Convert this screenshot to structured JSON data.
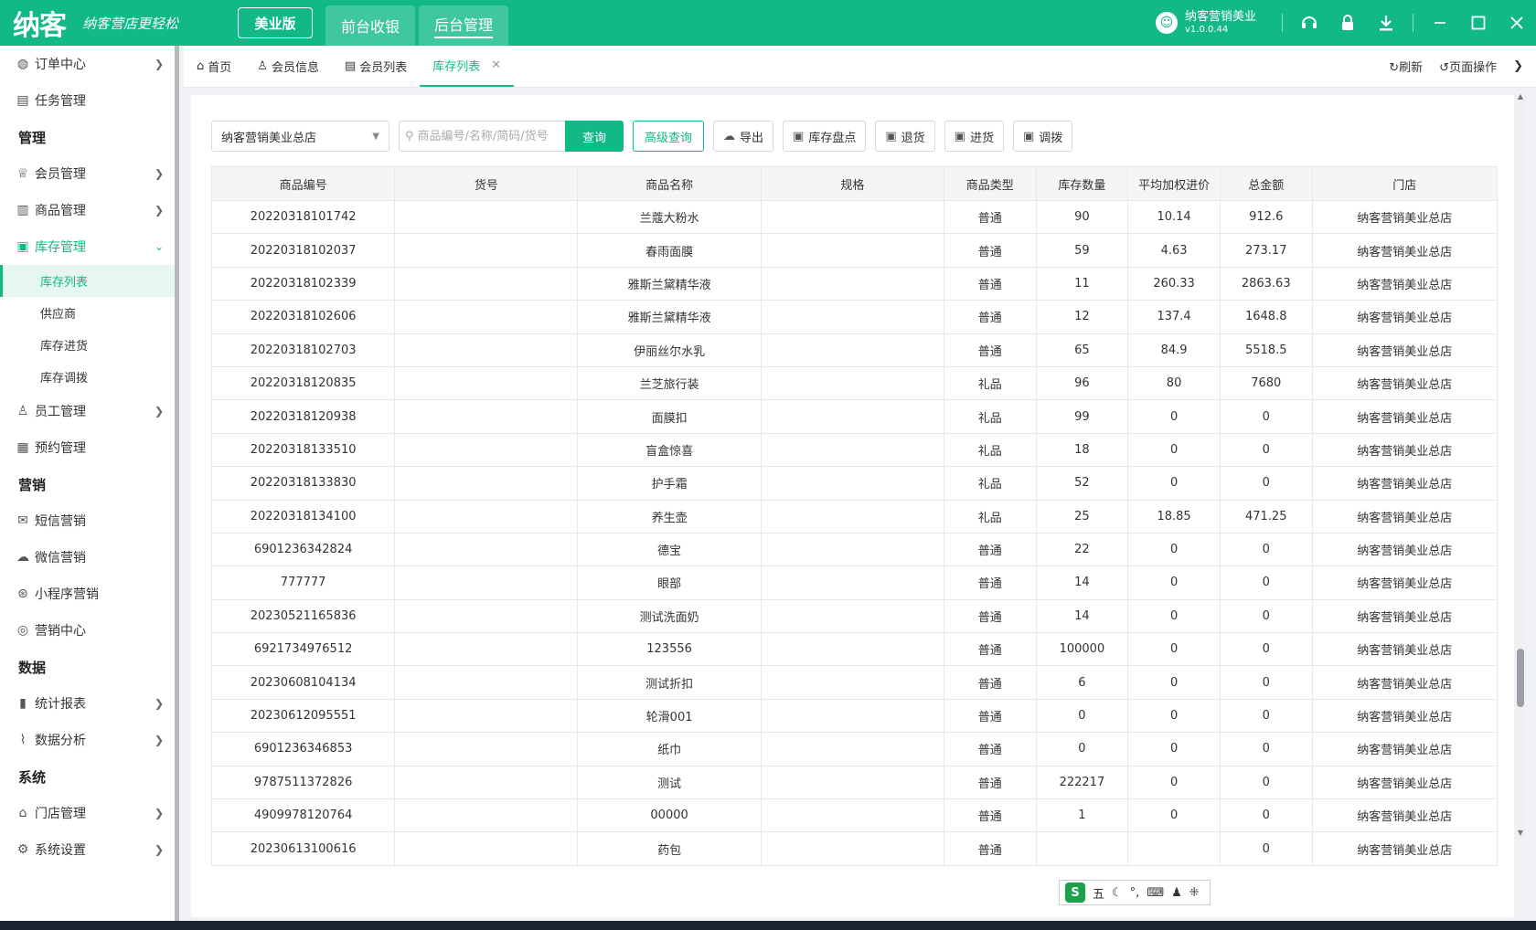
{
  "header": {
    "logo": "纳客",
    "slogan": "纳客营店更轻松",
    "edition": "美业版",
    "mode_tabs": [
      "前台收银",
      "后台管理"
    ],
    "user_name": "纳客营销美业",
    "version": "v1.0.0.44"
  },
  "sidebar": {
    "order_center": "订单中心",
    "task_mgmt": "任务管理",
    "section_manage": "管理",
    "member_mgmt": "会员管理",
    "product_mgmt": "商品管理",
    "inventory_mgmt": "库存管理",
    "inventory_sub": [
      "库存列表",
      "供应商",
      "库存进货",
      "库存调拨"
    ],
    "staff_mgmt": "员工管理",
    "booking_mgmt": "预约管理",
    "section_marketing": "营销",
    "sms_marketing": "短信营销",
    "wechat_marketing": "微信营销",
    "miniapp_marketing": "小程序营销",
    "marketing_center": "营销中心",
    "section_data": "数据",
    "stats_report": "统计报表",
    "data_analysis": "数据分析",
    "section_system": "系统",
    "store_mgmt": "门店管理",
    "system_settings": "系统设置"
  },
  "tabs": {
    "home": "首页",
    "member_info": "会员信息",
    "member_list": "会员列表",
    "inventory_list": "库存列表",
    "refresh": "刷新",
    "page_ops": "页面操作"
  },
  "toolbar": {
    "store": "纳客营销美业总店",
    "search_placeholder": "商品编号/名称/简码/货号",
    "query": "查询",
    "advanced": "高级查询",
    "export": "导出",
    "stocktake": "库存盘点",
    "return": "退货",
    "purchase": "进货",
    "transfer": "调拨"
  },
  "table": {
    "headers": [
      "商品编号",
      "货号",
      "商品名称",
      "规格",
      "商品类型",
      "库存数量",
      "平均加权进价",
      "总金额",
      "门店"
    ],
    "rows": [
      [
        "20220318101742",
        "",
        "兰蔻大粉水",
        "",
        "普通",
        "90",
        "10.14",
        "912.6",
        "纳客营销美业总店"
      ],
      [
        "20220318102037",
        "",
        "春雨面膜",
        "",
        "普通",
        "59",
        "4.63",
        "273.17",
        "纳客营销美业总店"
      ],
      [
        "20220318102339",
        "",
        "雅斯兰黛精华液",
        "",
        "普通",
        "11",
        "260.33",
        "2863.63",
        "纳客营销美业总店"
      ],
      [
        "20220318102606",
        "",
        "雅斯兰黛精华液",
        "",
        "普通",
        "12",
        "137.4",
        "1648.8",
        "纳客营销美业总店"
      ],
      [
        "20220318102703",
        "",
        "伊丽丝尔水乳",
        "",
        "普通",
        "65",
        "84.9",
        "5518.5",
        "纳客营销美业总店"
      ],
      [
        "20220318120835",
        "",
        "兰芝旅行装",
        "",
        "礼品",
        "96",
        "80",
        "7680",
        "纳客营销美业总店"
      ],
      [
        "20220318120938",
        "",
        "面膜扣",
        "",
        "礼品",
        "99",
        "0",
        "0",
        "纳客营销美业总店"
      ],
      [
        "20220318133510",
        "",
        "盲盒惊喜",
        "",
        "礼品",
        "18",
        "0",
        "0",
        "纳客营销美业总店"
      ],
      [
        "20220318133830",
        "",
        "护手霜",
        "",
        "礼品",
        "52",
        "0",
        "0",
        "纳客营销美业总店"
      ],
      [
        "20220318134100",
        "",
        "养生壶",
        "",
        "礼品",
        "25",
        "18.85",
        "471.25",
        "纳客营销美业总店"
      ],
      [
        "6901236342824",
        "",
        "德宝",
        "",
        "普通",
        "22",
        "0",
        "0",
        "纳客营销美业总店"
      ],
      [
        "777777",
        "",
        "眼部",
        "",
        "普通",
        "14",
        "0",
        "0",
        "纳客营销美业总店"
      ],
      [
        "20230521165836",
        "",
        "测试洗面奶",
        "",
        "普通",
        "14",
        "0",
        "0",
        "纳客营销美业总店"
      ],
      [
        "6921734976512",
        "",
        "123556",
        "",
        "普通",
        "100000",
        "0",
        "0",
        "纳客营销美业总店"
      ],
      [
        "20230608104134",
        "",
        "测试折扣",
        "",
        "普通",
        "6",
        "0",
        "0",
        "纳客营销美业总店"
      ],
      [
        "20230612095551",
        "",
        "轮滑001",
        "",
        "普通",
        "0",
        "0",
        "0",
        "纳客营销美业总店"
      ],
      [
        "6901236346853",
        "",
        "纸巾",
        "",
        "普通",
        "0",
        "0",
        "0",
        "纳客营销美业总店"
      ],
      [
        "9787511372826",
        "",
        "测试",
        "",
        "普通",
        "222217",
        "0",
        "0",
        "纳客营销美业总店"
      ],
      [
        "4909978120764",
        "",
        "00000",
        "",
        "普通",
        "1",
        "0",
        "0",
        "纳客营销美业总店"
      ],
      [
        "20230613100616",
        "",
        "药包",
        "",
        "普通",
        "",
        "",
        "0",
        "纳客营销美业总店"
      ]
    ]
  },
  "ime": {
    "logo": "S",
    "mode": "五"
  },
  "colors": {
    "brand": "#12b886"
  }
}
